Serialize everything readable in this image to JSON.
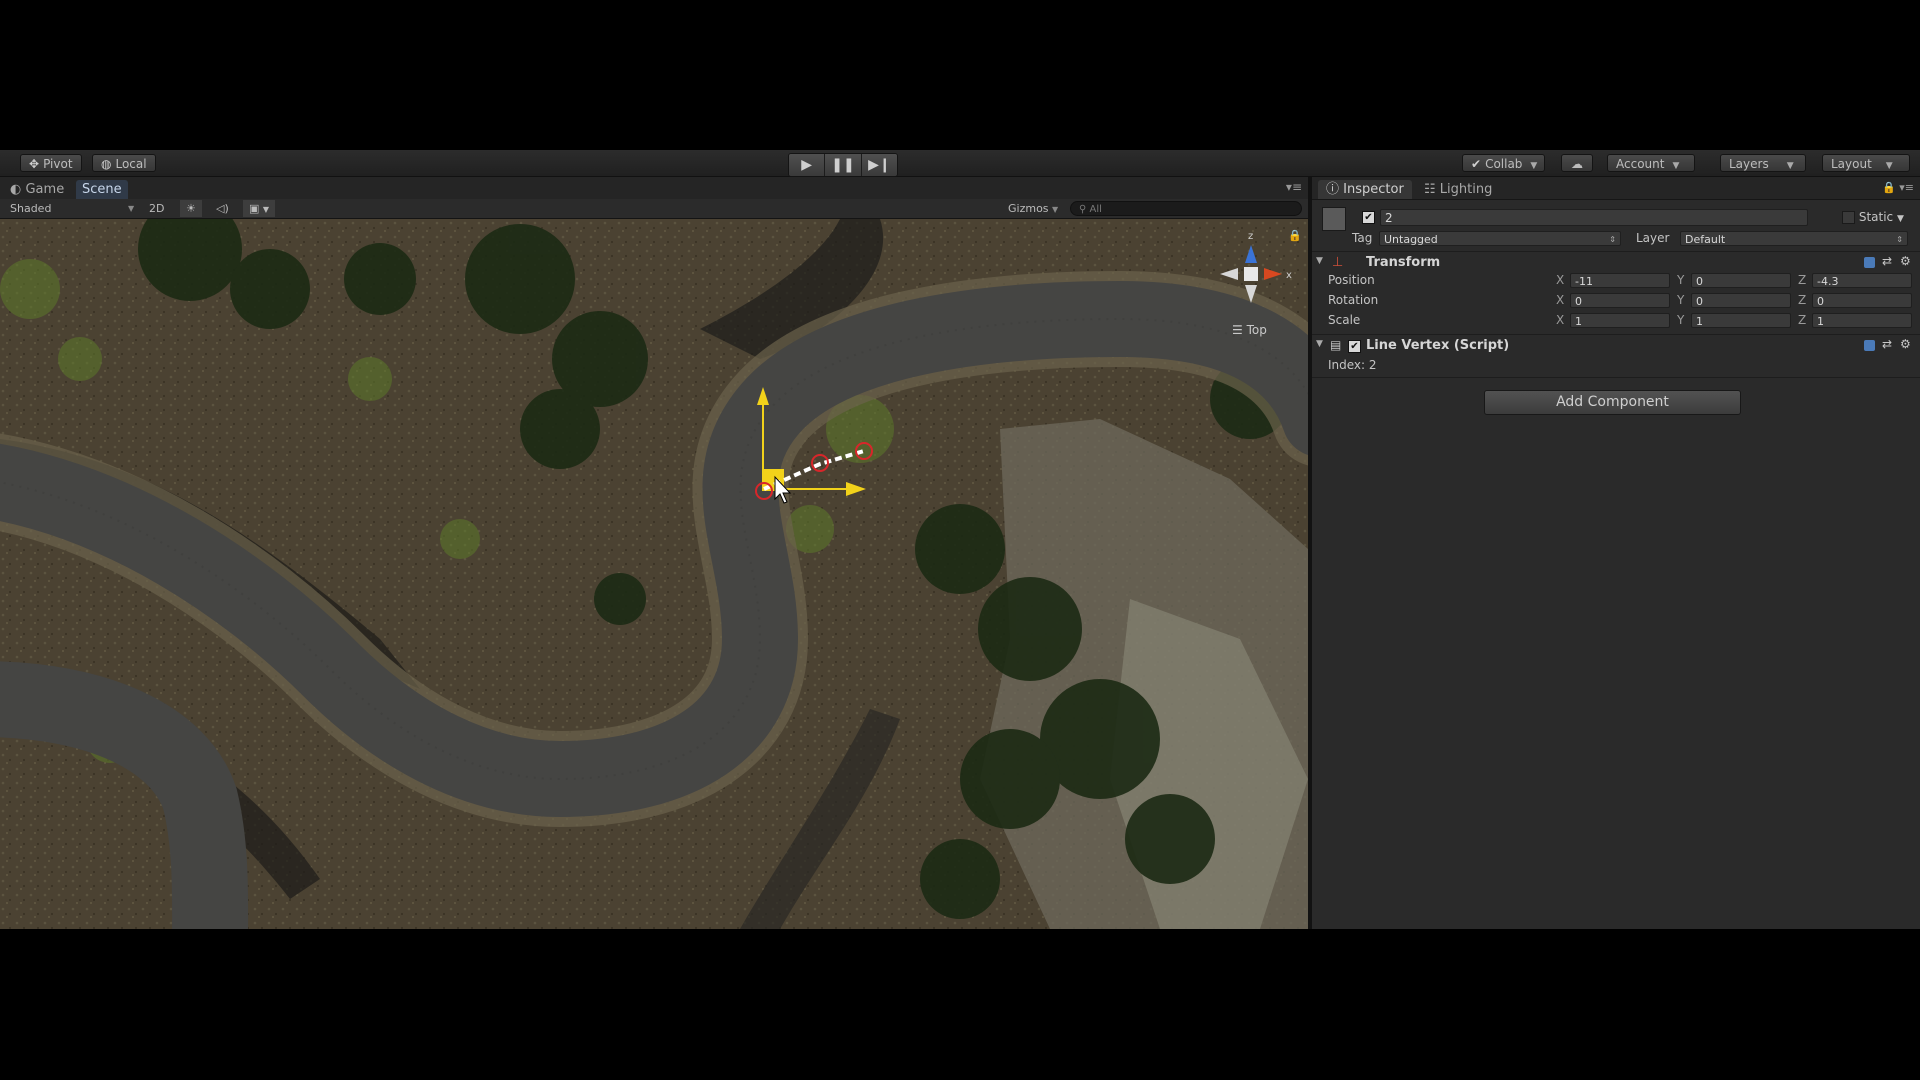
{
  "toolbar": {
    "pivot_label": "Pivot",
    "local_label": "Local",
    "collab_label": "Collab",
    "account_label": "Account",
    "layers_label": "Layers",
    "layout_label": "Layout"
  },
  "scene": {
    "tabs": {
      "game": "Game",
      "scene": "Scene"
    },
    "shading_mode": "Shaded",
    "mode_2d": "2D",
    "gizmos_label": "Gizmos",
    "search_placeholder": "All",
    "view_label": "Top",
    "gizmo_axes": {
      "z": "z",
      "x": "x"
    }
  },
  "inspector": {
    "tabs": {
      "inspector": "Inspector",
      "lighting": "Lighting"
    },
    "object_name": "2",
    "static_label": "Static",
    "tag_label": "Tag",
    "tag_value": "Untagged",
    "layer_label": "Layer",
    "layer_value": "Default",
    "transform": {
      "title": "Transform",
      "position": {
        "label": "Position",
        "x": "-11",
        "y": "0",
        "z": "-4.3"
      },
      "rotation": {
        "label": "Rotation",
        "x": "0",
        "y": "0",
        "z": "0"
      },
      "scale": {
        "label": "Scale",
        "x": "1",
        "y": "1",
        "z": "1"
      },
      "axis_x": "X",
      "axis_y": "Y",
      "axis_z": "Z"
    },
    "script": {
      "title": "Line Vertex (Script)",
      "index_text": "Index: 2"
    },
    "add_component_label": "Add Component"
  },
  "colors": {
    "selection_yellow": "#f2d21a",
    "vertex_red": "#d8262a",
    "road": "#4a4a48",
    "terrain": "#4a4030"
  }
}
